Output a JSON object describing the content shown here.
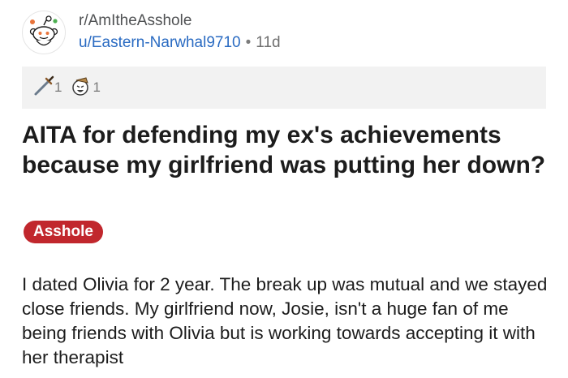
{
  "header": {
    "subreddit": "r/AmItheAsshole",
    "username": "u/Eastern-Narwhal9710",
    "separator": "•",
    "age": "11d",
    "avatar_icon": "snoo-avatar-icon"
  },
  "awards": [
    {
      "icon": "dagger-award-icon",
      "count": "1"
    },
    {
      "icon": "laughing-face-award-icon",
      "count": "1"
    }
  ],
  "post": {
    "title": "AITA for defending my ex's achievements because my girlfriend was putting her down?",
    "flair": "Asshole",
    "body": "I dated Olivia for 2 year. The break up was mutual and we stayed close friends. My girlfriend now, Josie, isn't a huge fan of me being friends with Olivia but is working towards accepting it with her therapist"
  },
  "colors": {
    "flair_bg": "#c1272d",
    "username": "#2a6bc2",
    "awards_bg": "#f2f2f2"
  }
}
